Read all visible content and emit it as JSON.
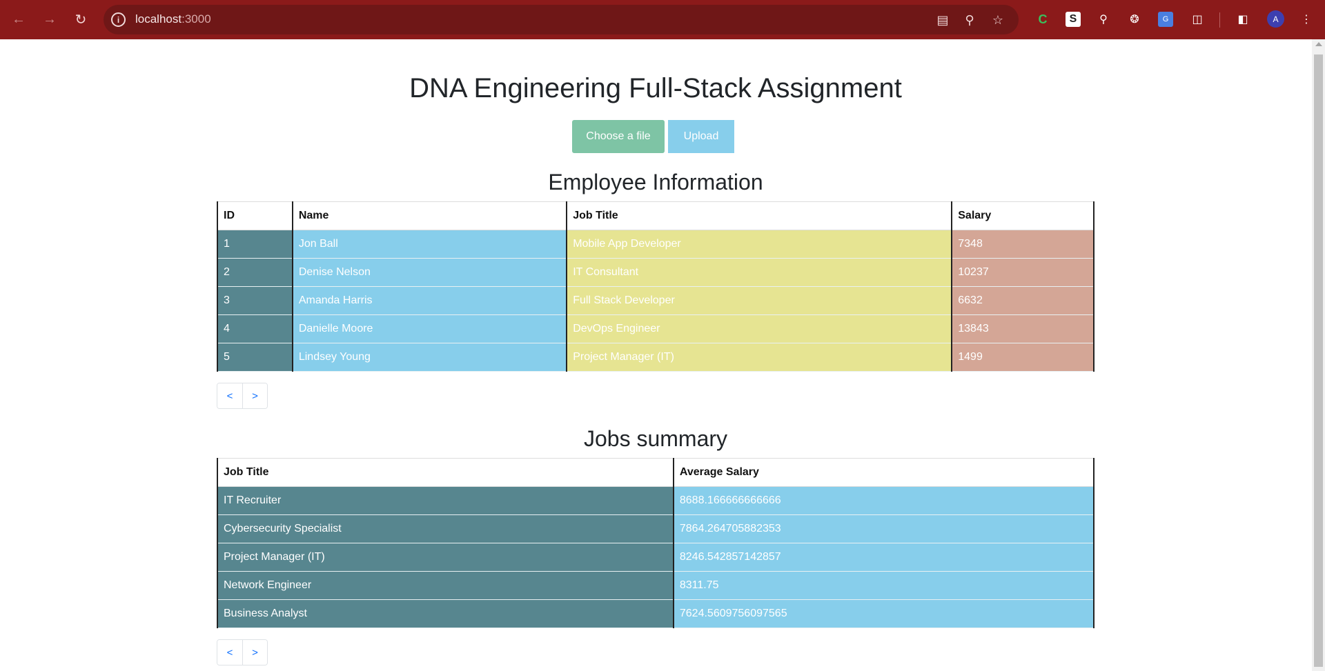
{
  "browser": {
    "url_host": "localhost",
    "url_port": ":3000",
    "avatar_letter": "A",
    "theme_color": "#8b1a1a"
  },
  "page": {
    "title": "DNA Engineering Full-Stack Assignment",
    "choose_label": "Choose a file",
    "upload_label": "Upload"
  },
  "employees": {
    "title": "Employee Information",
    "columns": [
      "ID",
      "Name",
      "Job Title",
      "Salary"
    ],
    "rows": [
      {
        "id": "1",
        "name": "Jon Ball",
        "job": "Mobile App Developer",
        "salary": "7348"
      },
      {
        "id": "2",
        "name": "Denise Nelson",
        "job": "IT Consultant",
        "salary": "10237"
      },
      {
        "id": "3",
        "name": "Amanda Harris",
        "job": "Full Stack Developer",
        "salary": "6632"
      },
      {
        "id": "4",
        "name": "Danielle Moore",
        "job": "DevOps Engineer",
        "salary": "13843"
      },
      {
        "id": "5",
        "name": "Lindsey Young",
        "job": "Project Manager (IT)",
        "salary": "1499"
      }
    ],
    "prev": "<",
    "next": ">"
  },
  "summary": {
    "title": "Jobs summary",
    "columns": [
      "Job Title",
      "Average Salary"
    ],
    "rows": [
      {
        "job": "IT Recruiter",
        "avg": "8688.166666666666"
      },
      {
        "job": "Cybersecurity Specialist",
        "avg": "7864.264705882353"
      },
      {
        "job": "Project Manager (IT)",
        "avg": "8246.542857142857"
      },
      {
        "job": "Network Engineer",
        "avg": "8311.75"
      },
      {
        "job": "Business Analyst",
        "avg": "7624.5609756097565"
      }
    ],
    "prev": "<",
    "next": ">"
  },
  "colors": {
    "id_col": "#57868f",
    "name_col": "#87ceeb",
    "job_col": "#e6e492",
    "salary_col": "#d4a696",
    "choose_btn": "#7ec4a5",
    "upload_btn": "#87ceeb"
  }
}
